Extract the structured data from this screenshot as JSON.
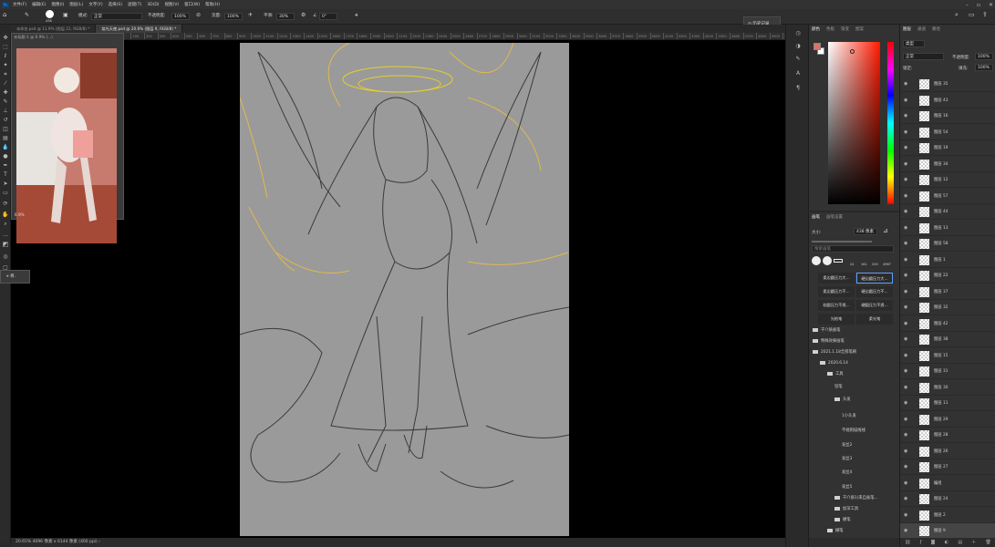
{
  "menubar": {
    "app_icon": "Ps",
    "items": [
      "文件(F)",
      "编辑(E)",
      "图像(I)",
      "图层(L)",
      "文字(Y)",
      "选择(S)",
      "滤镜(T)",
      "3D(D)",
      "视图(V)",
      "窗口(W)",
      "帮助(H)"
    ]
  },
  "options": {
    "brush_size": "438",
    "mode_label": "模式:",
    "mode_value": "正常",
    "opacity_label": "不透明度:",
    "opacity_value": "100%",
    "flow_label": "流量:",
    "flow_value": "100%",
    "smooth_label": "平滑:",
    "smooth_value": "30%",
    "angle_value": "0°"
  },
  "history_button": "历史记录",
  "tabs": [
    "未命名.psd @ 11.9% (图层 21, RGB/8) *",
    "烧光天使.psd @ 20.6% (图层 9, RGB/8) *"
  ],
  "ruler": [
    "-800",
    "-700",
    "-600",
    "-500",
    "-400",
    "-300",
    "-200",
    "-100",
    "0",
    "100",
    "200",
    "300",
    "400",
    "500",
    "600",
    "700",
    "800",
    "900",
    "1000",
    "1100",
    "1200",
    "1300",
    "1400",
    "1500",
    "1600",
    "1700",
    "1800",
    "1900",
    "2000",
    "2100",
    "2200",
    "2300",
    "2400",
    "2500",
    "2600",
    "2700",
    "2800",
    "2900",
    "3000",
    "3100",
    "3200",
    "3300",
    "3400",
    "3500",
    "3600",
    "3700",
    "3800",
    "3900",
    "4000",
    "4100",
    "4200",
    "4300",
    "4400",
    "4500",
    "4600",
    "4700",
    "4800",
    "4900",
    "5000",
    "5100",
    "5200",
    "5300"
  ],
  "navigator": {
    "title": "未标题-1 @ 6.9% (...)",
    "zoom": "6.9%"
  },
  "status": "20.65%   4096 像素 x 6144 像素 (400 ppi)   ›",
  "colorpanel": {
    "tabs": [
      "颜色",
      "色板",
      "渐变",
      "图案"
    ],
    "fg": "#e07060",
    "bg": "#ffffff"
  },
  "brushpanel": {
    "tabs": [
      "画笔",
      "画笔设置"
    ],
    "size_label": "大小:",
    "size_value": "438 像素",
    "search_placeholder": "搜索画笔",
    "tips": [
      "24",
      "161",
      "200",
      "4967"
    ],
    "presets": [
      "柔边圆压力大…",
      "硬边圆压力大…",
      "柔边圆压力不…",
      "硬边圆压力不…",
      "软圆压力不透…",
      "硬圆压力不透…",
      "光枪笔",
      "柔光笔"
    ],
    "groups": [
      "干介质画笔",
      "特殊效果画笔",
      "2021.1.18全部笔刷",
      "2020.6.14",
      "工具",
      "铅笔",
      "头发",
      "1小头发",
      "不规则描线线",
      "发丝2",
      "发丝3",
      "发丝4",
      "发丝5",
      "干介质1(来自画笔…",
      "加深工具",
      "硬笔",
      "糊笔"
    ]
  },
  "layers": {
    "tabs": [
      "图层",
      "通道",
      "路径"
    ],
    "kind_label": "类型",
    "blend": "正常",
    "opacity_label": "不透明度:",
    "opacity": "100%",
    "lock_label": "锁定:",
    "fill_label": "填充:",
    "fill": "100%",
    "rows": [
      "图层 35",
      "图层 43",
      "图层 16",
      "图层 54",
      "图层 19",
      "图层 34",
      "图层 12",
      "图层 57",
      "图层 44",
      "图层 13",
      "图层 58",
      "图层 1",
      "图层 22",
      "图层 37",
      "图层 32",
      "图层 42",
      "图层 38",
      "图层 15",
      "图层 31",
      "图层 30",
      "图层 11",
      "图层 29",
      "图层 28",
      "图层 26",
      "图层 27",
      "编组",
      "图层 24",
      "图层 2",
      "图层 9"
    ]
  }
}
